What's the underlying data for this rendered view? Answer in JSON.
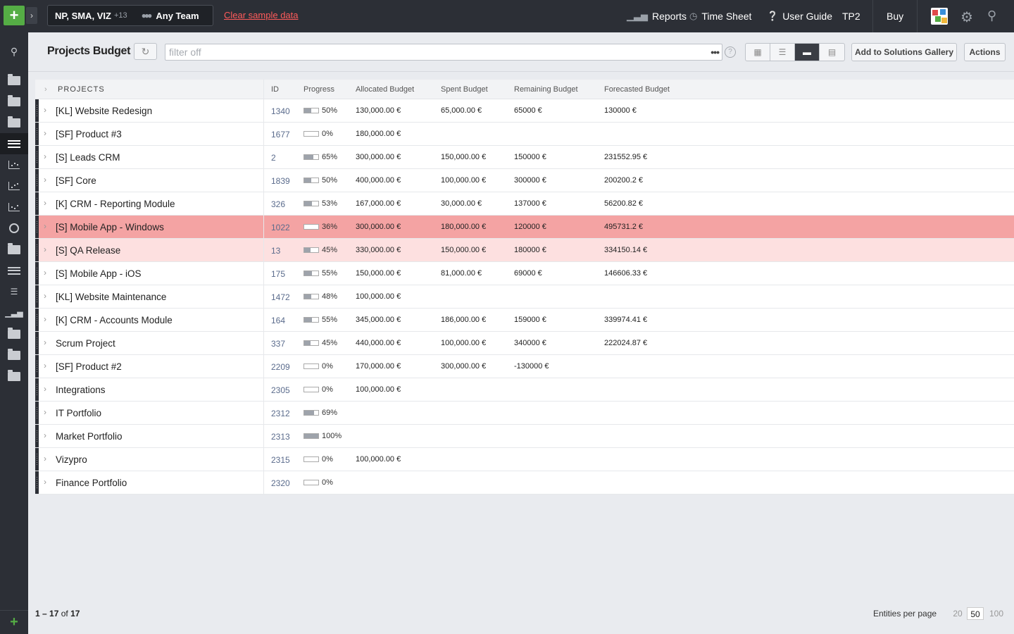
{
  "topbar": {
    "add_label": "+",
    "context_label": "NP, SMA, VIZ",
    "context_more": "+13",
    "team_label": "Any Team",
    "clear_link": "Clear sample data",
    "reports": "Reports",
    "timesheet": "Time Sheet",
    "user_guide": "User Guide",
    "tp2": "TP2",
    "buy": "Buy"
  },
  "header": {
    "title": "Projects Budget",
    "filter_placeholder": "filter off",
    "filter_more": "•••",
    "help": "?",
    "add_gallery": "Add to Solutions Gallery",
    "actions": "Actions"
  },
  "table": {
    "columns": {
      "projects": "PROJECTS",
      "id": "ID",
      "progress": "Progress",
      "allocated": "Allocated Budget",
      "spent": "Spent Budget",
      "remaining": "Remaining Budget",
      "forecasted": "Forecasted Budget"
    },
    "rows": [
      {
        "name": "[KL] Website Redesign",
        "id": "1340",
        "progress": "50%",
        "fill": 0.5,
        "allocated": "130,000.00 €",
        "spent": "65,000.00 €",
        "remaining": "65000 €",
        "forecasted": "130000 €",
        "state": ""
      },
      {
        "name": "[SF] Product #3",
        "id": "1677",
        "progress": "0%",
        "fill": 0,
        "allocated": "180,000.00 €",
        "spent": "",
        "remaining": "",
        "forecasted": "",
        "state": ""
      },
      {
        "name": "[S] Leads CRM",
        "id": "2",
        "progress": "65%",
        "fill": 0.65,
        "allocated": "300,000.00 €",
        "spent": "150,000.00 €",
        "remaining": "150000 €",
        "forecasted": "231552.95 €",
        "state": ""
      },
      {
        "name": "[SF] Core",
        "id": "1839",
        "progress": "50%",
        "fill": 0.5,
        "allocated": "400,000.00 €",
        "spent": "100,000.00 €",
        "remaining": "300000 €",
        "forecasted": "200200.2 €",
        "state": ""
      },
      {
        "name": "[K] CRM - Reporting Module",
        "id": "326",
        "progress": "53%",
        "fill": 0.53,
        "allocated": "167,000.00 €",
        "spent": "30,000.00 €",
        "remaining": "137000 €",
        "forecasted": "56200.82 €",
        "state": ""
      },
      {
        "name": "[S] Mobile App - Windows",
        "id": "1022",
        "progress": "36%",
        "fill": 0.36,
        "allocated": "300,000.00 €",
        "spent": "180,000.00 €",
        "remaining": "120000 €",
        "forecasted": "495731.2 €",
        "state": "hl"
      },
      {
        "name": "[S] QA Release",
        "id": "13",
        "progress": "45%",
        "fill": 0.45,
        "allocated": "330,000.00 €",
        "spent": "150,000.00 €",
        "remaining": "180000 €",
        "forecasted": "334150.14 €",
        "state": "hl-light"
      },
      {
        "name": "[S] Mobile App - iOS",
        "id": "175",
        "progress": "55%",
        "fill": 0.55,
        "allocated": "150,000.00 €",
        "spent": "81,000.00 €",
        "remaining": "69000 €",
        "forecasted": "146606.33 €",
        "state": ""
      },
      {
        "name": "[KL] Website Maintenance",
        "id": "1472",
        "progress": "48%",
        "fill": 0.48,
        "allocated": "100,000.00 €",
        "spent": "",
        "remaining": "",
        "forecasted": "",
        "state": ""
      },
      {
        "name": "[K] CRM - Accounts Module",
        "id": "164",
        "progress": "55%",
        "fill": 0.55,
        "allocated": "345,000.00 €",
        "spent": "186,000.00 €",
        "remaining": "159000 €",
        "forecasted": "339974.41 €",
        "state": ""
      },
      {
        "name": "Scrum Project",
        "id": "337",
        "progress": "45%",
        "fill": 0.45,
        "allocated": "440,000.00 €",
        "spent": "100,000.00 €",
        "remaining": "340000 €",
        "forecasted": "222024.87 €",
        "state": ""
      },
      {
        "name": "[SF] Product #2",
        "id": "2209",
        "progress": "0%",
        "fill": 0,
        "allocated": "170,000.00 €",
        "spent": "300,000.00 €",
        "remaining": "-130000 €",
        "forecasted": "",
        "state": ""
      },
      {
        "name": "Integrations",
        "id": "2305",
        "progress": "0%",
        "fill": 0,
        "allocated": "100,000.00 €",
        "spent": "",
        "remaining": "",
        "forecasted": "",
        "state": ""
      },
      {
        "name": "IT Portfolio",
        "id": "2312",
        "progress": "69%",
        "fill": 0.69,
        "allocated": "",
        "spent": "",
        "remaining": "",
        "forecasted": "",
        "state": ""
      },
      {
        "name": "Market Portfolio",
        "id": "2313",
        "progress": "100%",
        "fill": 1,
        "allocated": "",
        "spent": "",
        "remaining": "",
        "forecasted": "",
        "state": ""
      },
      {
        "name": "Vizypro",
        "id": "2315",
        "progress": "0%",
        "fill": 0,
        "allocated": "100,000.00 €",
        "spent": "",
        "remaining": "",
        "forecasted": "",
        "state": ""
      },
      {
        "name": "Finance Portfolio",
        "id": "2320",
        "progress": "0%",
        "fill": 0,
        "allocated": "",
        "spent": "",
        "remaining": "",
        "forecasted": "",
        "state": ""
      }
    ]
  },
  "footer": {
    "range": "1 – 17",
    "of": "of",
    "total": "17",
    "per_page_label": "Entities per page",
    "per_page_options": [
      "20",
      "50",
      "100"
    ],
    "per_page_selected": "50"
  },
  "colors": {
    "accent_green": "#55ad45",
    "highlight_row": "#f4a3a3",
    "highlight_row_light": "#fde0e0",
    "clear_link": "#ff5b5b"
  }
}
